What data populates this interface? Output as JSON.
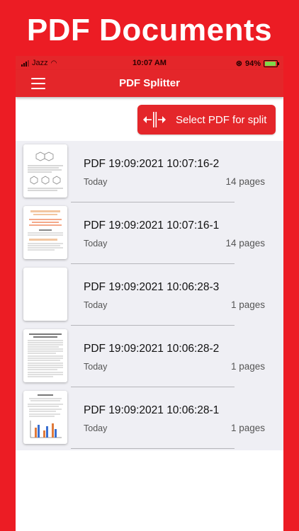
{
  "promo": {
    "title": "PDF Documents"
  },
  "status_bar": {
    "carrier": "Jazz",
    "time": "10:07 AM",
    "battery": "94%",
    "battery_level": 0.94
  },
  "navbar": {
    "title": "PDF Splitter",
    "menu_icon": "hamburger-menu-icon"
  },
  "split_button": {
    "label": "Select PDF for split",
    "icon": "split-icon"
  },
  "files": [
    {
      "name": "PDF 19:09:2021 10:07:16-2",
      "date": "Today",
      "pages": "14 pages",
      "thumb": "chemistry-document"
    },
    {
      "name": "PDF 19:09:2021 10:07:16-1",
      "date": "Today",
      "pages": "14 pages",
      "thumb": "highlighted-document"
    },
    {
      "name": "PDF 19:09:2021 10:06:28-3",
      "date": "Today",
      "pages": "1 pages",
      "thumb": "blank-document"
    },
    {
      "name": "PDF 19:09:2021 10:06:28-2",
      "date": "Today",
      "pages": "1 pages",
      "thumb": "text-document"
    },
    {
      "name": "PDF 19:09:2021 10:06:28-1",
      "date": "Today",
      "pages": "1 pages",
      "thumb": "chart-document"
    }
  ],
  "colors": {
    "brand_red": "#ec1c24",
    "nav_red": "#e4262a",
    "list_bg": "#efeff4"
  }
}
